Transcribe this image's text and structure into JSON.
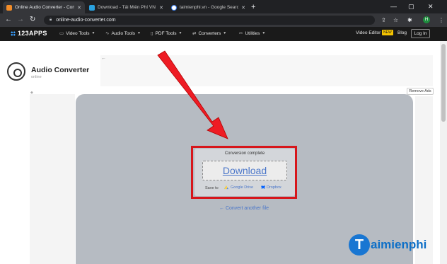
{
  "browser": {
    "tabs": [
      {
        "title": "Online Audio Converter - Conve",
        "favicon_color": "#f28c28",
        "active": true
      },
      {
        "title": "Download - Tải Miễn Phí VN - Ph",
        "favicon_color": "#2aa2e0",
        "active": false
      },
      {
        "title": "taimienphi.vn - Google Search",
        "favicon_color": "#ffffff",
        "active": false
      }
    ],
    "new_tab": "+",
    "window_controls": {
      "minimize": "—",
      "maximize": "▢",
      "close": "✕"
    },
    "back": "←",
    "forward": "→",
    "reload": "↻",
    "url": "online-audio-converter.com",
    "profile_initial": "H"
  },
  "site_nav": {
    "logo": "123APPS",
    "menus": [
      {
        "label": "Video Tools",
        "icon": "video-icon"
      },
      {
        "label": "Audio Tools",
        "icon": "audio-wave-icon"
      },
      {
        "label": "PDF Tools",
        "icon": "document-icon"
      },
      {
        "label": "Converters",
        "icon": "convert-icon"
      },
      {
        "label": "Utilities",
        "icon": "utilities-icon"
      }
    ],
    "video_editor": "Video Editor",
    "new_badge": "NEW",
    "blog": "Blog",
    "login": "Log In"
  },
  "app": {
    "title": "Audio Converter",
    "subtitle": "online",
    "remove_ads": "Remove Ads",
    "ad_back": "←"
  },
  "result": {
    "status": "Conversion complete",
    "download": "Download",
    "save_to": "Save to",
    "google_drive": "Google Drive",
    "dropbox": "Dropbox",
    "convert_another": "← Convert another file"
  },
  "watermark": {
    "letter": "T",
    "text": "aimienphi"
  },
  "colors": {
    "accent": "#4a76c9",
    "highlight": "#d7161b",
    "work_area": "#b6bbc2"
  }
}
